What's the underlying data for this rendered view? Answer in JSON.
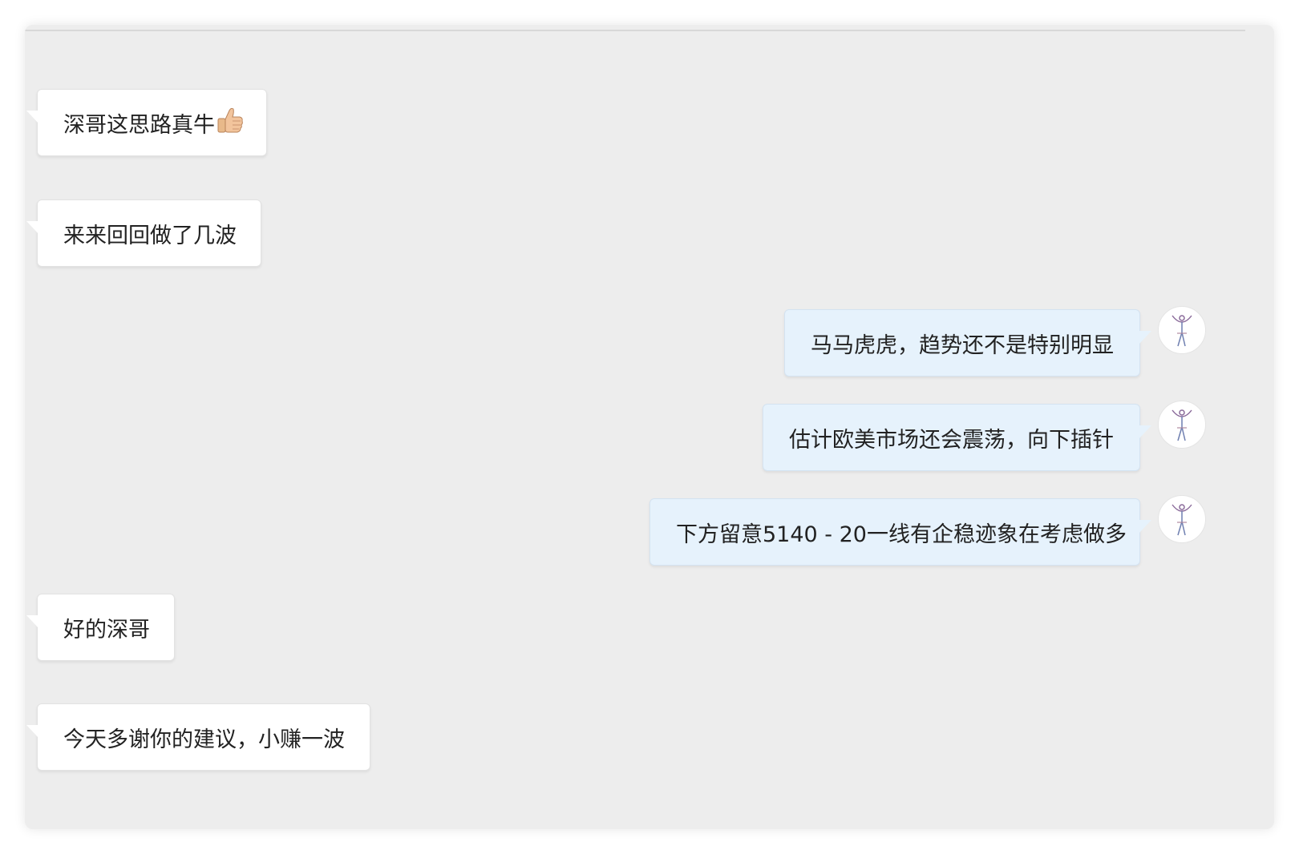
{
  "messages": [
    {
      "side": "incoming",
      "text": "深哥这思路真牛",
      "emoji": "thumbs-up-icon"
    },
    {
      "side": "incoming",
      "text": "来来回回做了几波"
    },
    {
      "side": "outgoing",
      "text": "马马虎虎，趋势还不是特别明显"
    },
    {
      "side": "outgoing",
      "text": "估计欧美市场还会震荡，向下插针"
    },
    {
      "side": "outgoing",
      "text": "下方留意5140 - 20一线有企稳迹象在考虑做多"
    },
    {
      "side": "incoming",
      "text": "好的深哥"
    },
    {
      "side": "incoming",
      "text": "今天多谢你的建议，小赚一波"
    }
  ],
  "colors": {
    "background": "#ededed",
    "incoming_bubble": "#ffffff",
    "outgoing_bubble": "#e6f2fc",
    "avatar_figure": "#8a6a9a"
  }
}
